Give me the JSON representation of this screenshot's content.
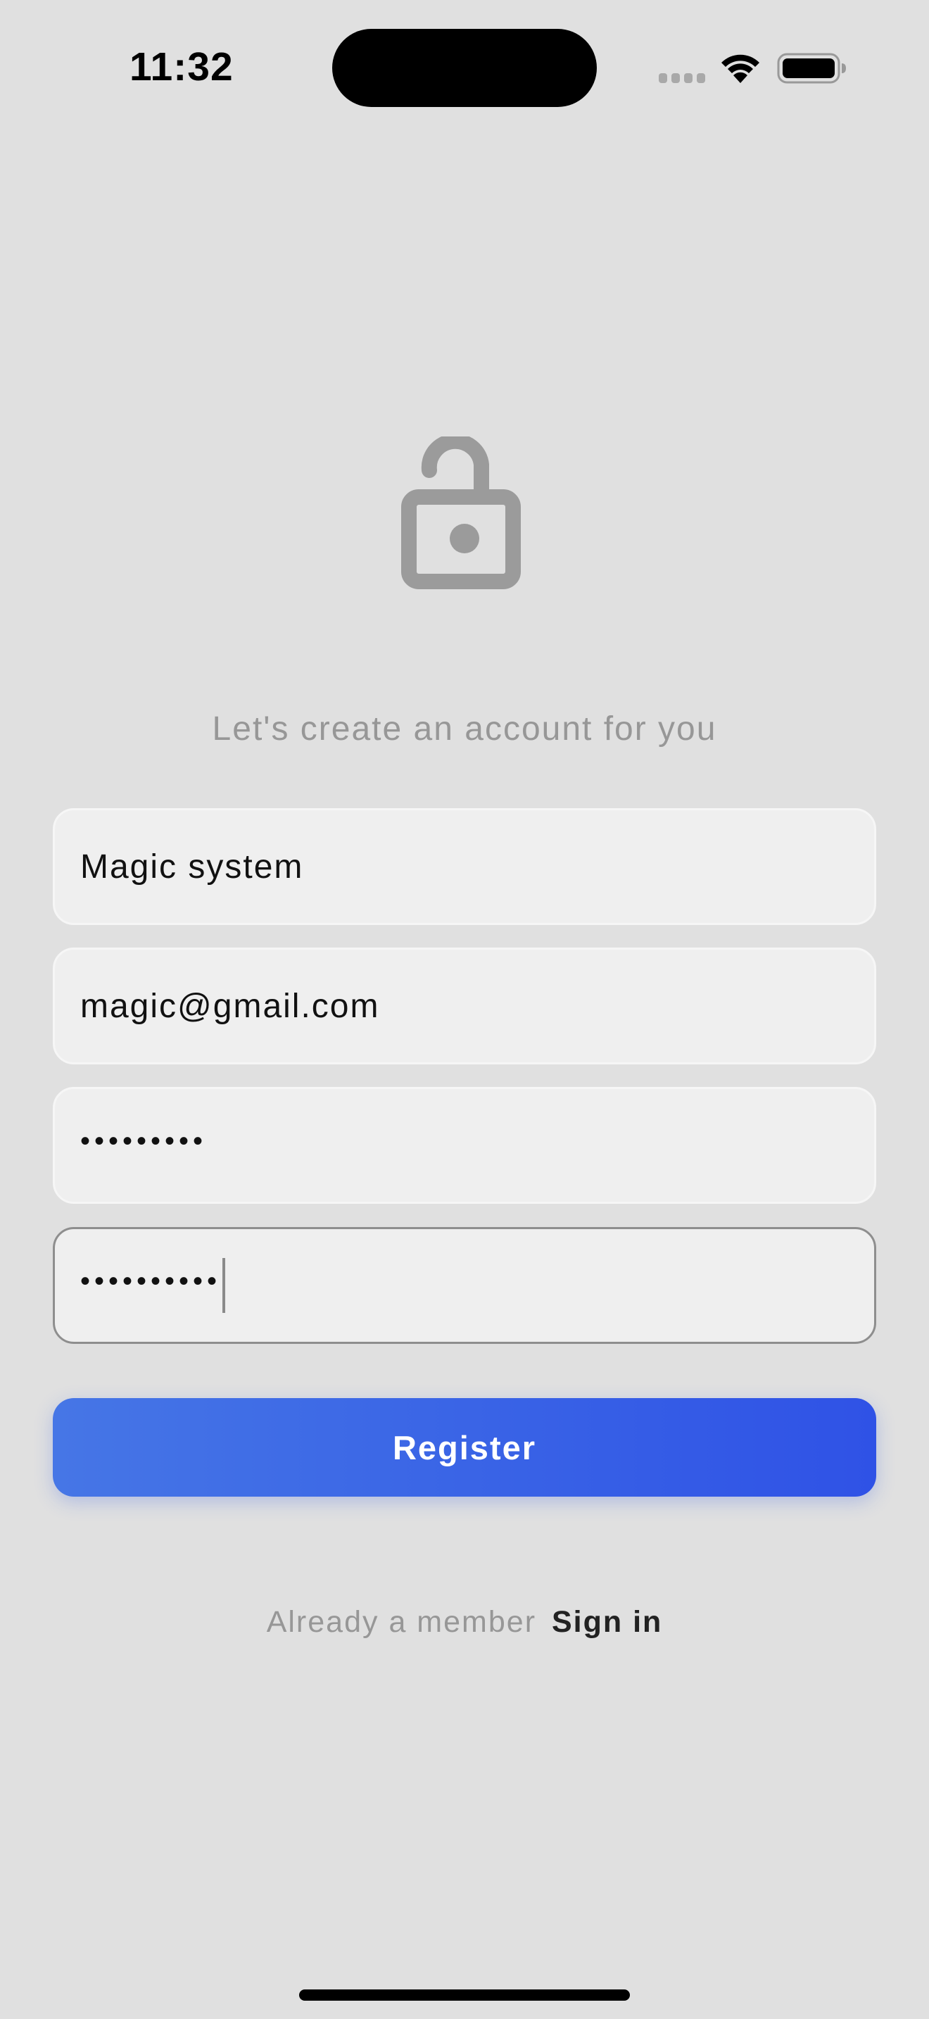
{
  "status_bar": {
    "time": "11:32"
  },
  "header": {
    "subtitle": "Let's create an account for you"
  },
  "form": {
    "name_value": "Magic system",
    "email_value": "magic@gmail.com",
    "password_value": "•••••••••",
    "confirm_password_value": "••••••••••"
  },
  "actions": {
    "register_label": "Register",
    "signin_prompt": "Already a member",
    "signin_link": "Sign in"
  },
  "icons": {
    "lock": "unlocked-padlock-icon",
    "signal": "cellular-signal-icon",
    "wifi": "wifi-icon",
    "battery": "battery-icon"
  },
  "colors": {
    "background": "#e0e0e0",
    "field_background": "#efefef",
    "button_gradient_start": "#4676e6",
    "button_gradient_end": "#2f52e6",
    "muted_text": "#979797",
    "icon_gray": "#9b9b9b"
  }
}
